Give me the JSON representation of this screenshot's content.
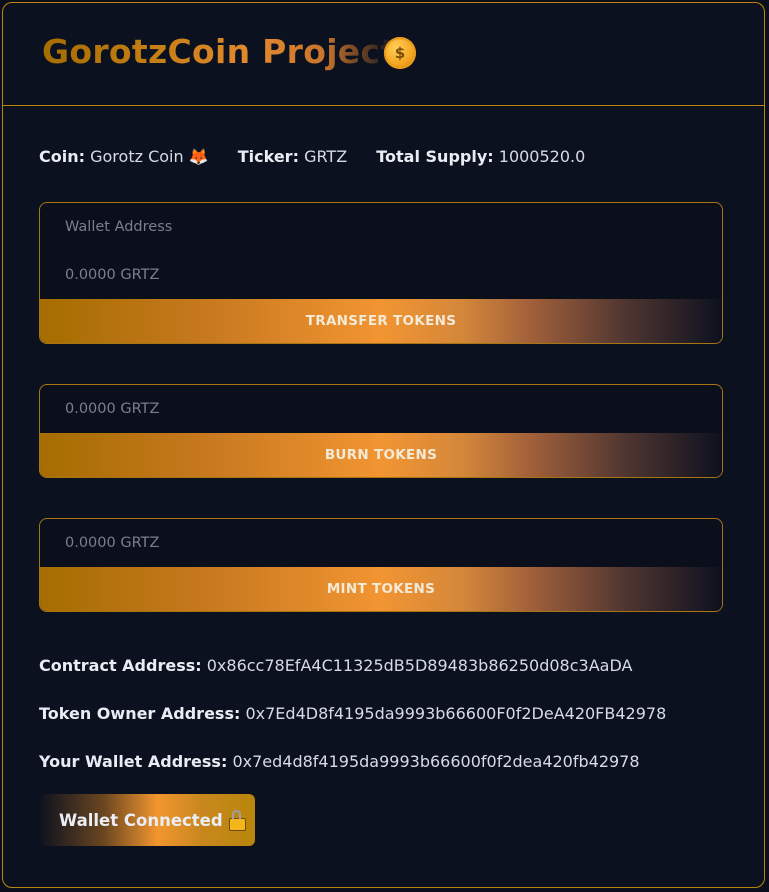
{
  "header": {
    "title": "GorotzCoin Project",
    "coin_icon_symbol": "$",
    "coin_icon": "coin-icon"
  },
  "token_info": {
    "coin_label": "Coin:",
    "coin_value": "Gorotz Coin",
    "coin_emoji": "🦊",
    "ticker_label": "Ticker:",
    "ticker_value": "GRTZ",
    "supply_label": "Total Supply:",
    "supply_value": "1000520.0"
  },
  "transfer": {
    "address_placeholder": "Wallet Address",
    "amount_placeholder": "0.0000 GRTZ",
    "button_label": "TRANSFER TOKENS"
  },
  "burn": {
    "amount_placeholder": "0.0000 GRTZ",
    "button_label": "BURN TOKENS"
  },
  "mint": {
    "amount_placeholder": "0.0000 GRTZ",
    "button_label": "MINT TOKENS"
  },
  "addresses": {
    "contract_label": "Contract Address:",
    "contract_value": "0x86cc78EfA4C11325dB5D89483b86250d08c3AaDA",
    "owner_label": "Token Owner Address:",
    "owner_value": "0x7Ed4D8f4195da9993b66600F0f2DeA420FB42978",
    "wallet_label": "Your Wallet Address:",
    "wallet_value": "0x7ed4d8f4195da9993b66600f0f2dea420fb42978"
  },
  "wallet_button": {
    "label": "Wallet Connected",
    "icon": "lock-icon"
  },
  "colors": {
    "background": "#0c111f",
    "border": "#b8860b",
    "accent_orange": "#f29532",
    "accent_gold": "#a56d00"
  }
}
